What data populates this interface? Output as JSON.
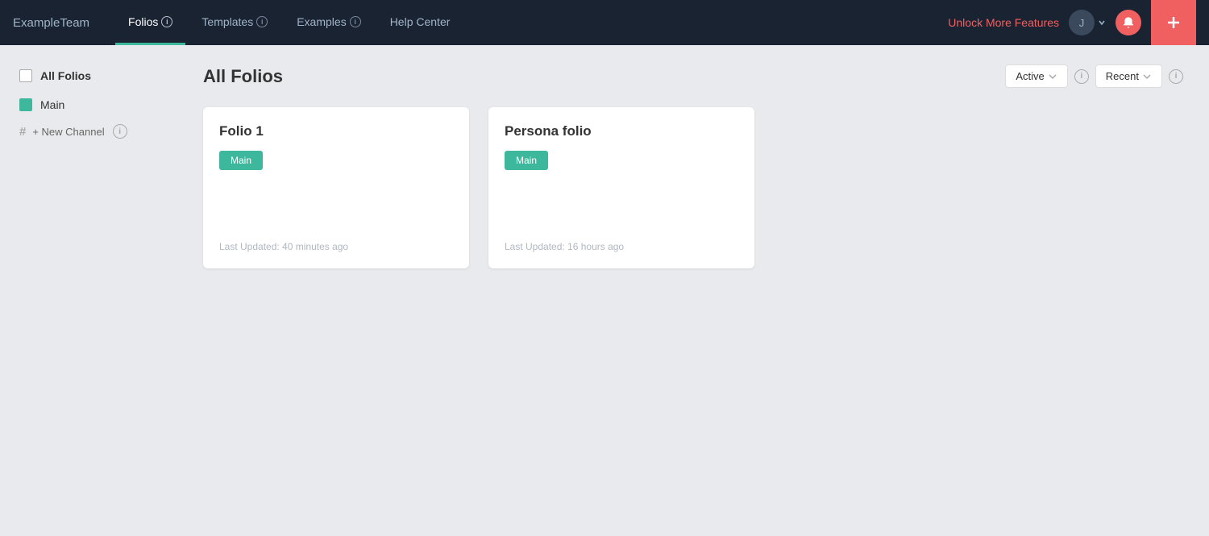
{
  "brand": "ExampleTeam",
  "nav": {
    "tabs": [
      {
        "id": "folios",
        "label": "Folios",
        "active": true
      },
      {
        "id": "templates",
        "label": "Templates",
        "active": false
      },
      {
        "id": "examples",
        "label": "Examples",
        "active": false
      },
      {
        "id": "help",
        "label": "Help Center",
        "active": false
      }
    ]
  },
  "topnav_right": {
    "unlock_label": "Unlock More Features",
    "user_initial": "J",
    "add_icon": "+"
  },
  "sidebar": {
    "all_folios_label": "All Folios",
    "channels": [
      {
        "label": "Main"
      }
    ],
    "new_channel_label": "+ New Channel"
  },
  "main": {
    "page_title": "All Folios",
    "filters": {
      "status_label": "Active",
      "sort_label": "Recent"
    },
    "folios": [
      {
        "title": "Folio 1",
        "tag": "Main",
        "updated": "Last Updated: 40 minutes ago"
      },
      {
        "title": "Persona folio",
        "tag": "Main",
        "updated": "Last Updated: 16 hours ago"
      }
    ]
  }
}
